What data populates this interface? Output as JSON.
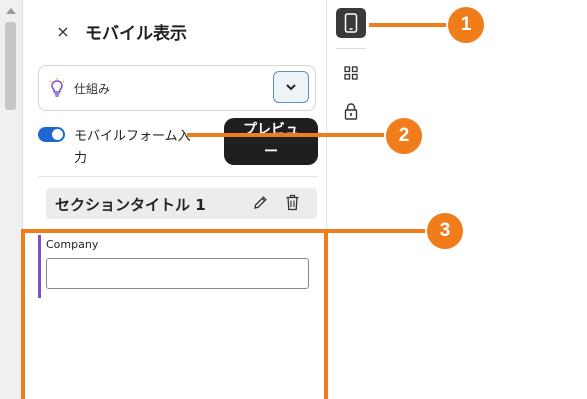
{
  "panel": {
    "close_glyph": "×",
    "title": "モバイル表示",
    "dropdown": {
      "icon": "lightbulb-icon",
      "label": "仕組み"
    },
    "toggle": {
      "on": true,
      "label": "モバイルフォーム入力"
    },
    "preview_button": {
      "label_line1": "プレビュ",
      "label_line2": "ー"
    },
    "section": {
      "title": "セクションタイトル 1"
    },
    "field": {
      "label": "Company",
      "value": ""
    }
  },
  "rail": {
    "items": [
      {
        "icon": "mobile-phone-icon",
        "active": true
      },
      {
        "icon": "grid-icon",
        "active": false
      },
      {
        "icon": "lock-icon",
        "active": false
      }
    ]
  },
  "callouts": [
    {
      "number": "1"
    },
    {
      "number": "2"
    },
    {
      "number": "3"
    }
  ],
  "colors": {
    "callout": "#f07d1a",
    "toggle_on": "#1e66d0",
    "field_accent": "#7a52c9",
    "preview_button_bg": "#1f1f1f"
  }
}
